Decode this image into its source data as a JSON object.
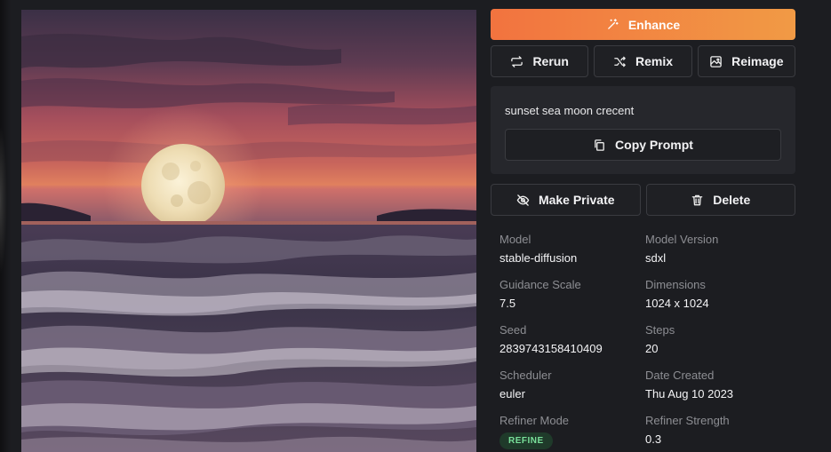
{
  "image": {
    "alt_icon": "generated-image",
    "colors": {
      "sky_top": "#3f3148",
      "sky_mid": "#b55a5c",
      "horizon": "#e07a5c",
      "sea": "#3d3547",
      "moon": "#efe2c0"
    }
  },
  "actions": {
    "enhance_label": "Enhance",
    "rerun_label": "Rerun",
    "remix_label": "Remix",
    "reimage_label": "Reimage",
    "make_private_label": "Make Private",
    "delete_label": "Delete",
    "accent": "#f2733f"
  },
  "prompt": {
    "text": "sunset sea moon crecent",
    "copy_label": "Copy Prompt"
  },
  "meta": [
    {
      "key": "Model",
      "value": "stable-diffusion"
    },
    {
      "key": "Model Version",
      "value": "sdxl"
    },
    {
      "key": "Guidance Scale",
      "value": "7.5"
    },
    {
      "key": "Dimensions",
      "value": "1024 x 1024"
    },
    {
      "key": "Seed",
      "value": "2839743158410409"
    },
    {
      "key": "Steps",
      "value": "20"
    },
    {
      "key": "Scheduler",
      "value": "euler"
    },
    {
      "key": "Date Created",
      "value": "Thu Aug 10 2023"
    },
    {
      "key": "Refiner Mode",
      "badge": "REFINE"
    },
    {
      "key": "Refiner Strength",
      "value": "0.3"
    }
  ]
}
